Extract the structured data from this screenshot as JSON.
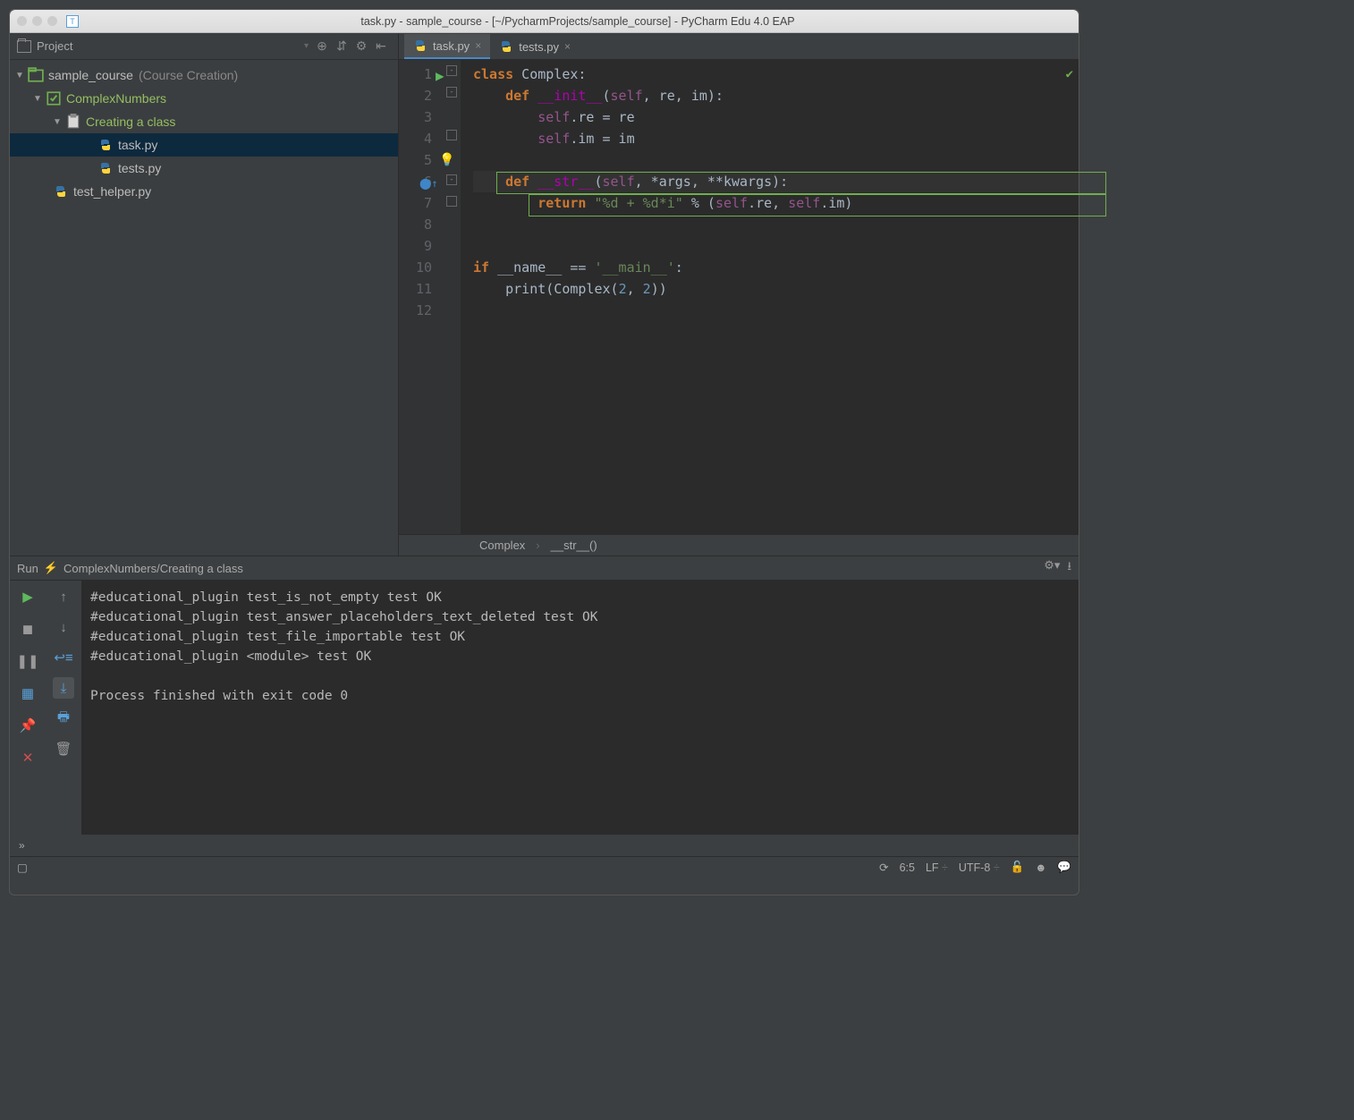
{
  "window": {
    "title": "task.py - sample_course - [~/PycharmProjects/sample_course] - PyCharm Edu 4.0 EAP"
  },
  "sidebar": {
    "header": "Project",
    "root": "sample_course",
    "root_hint": "(Course Creation)",
    "items": {
      "lesson": "ComplexNumbers",
      "task": "Creating a class",
      "file1": "task.py",
      "file2": "tests.py",
      "helper": "test_helper.py"
    }
  },
  "tabs": {
    "t0": "task.py",
    "t1": "tests.py"
  },
  "code": {
    "l1a": "class",
    "l1b": " Complex:",
    "l2a": "    def ",
    "l2b": "__init__",
    "l2c": "(",
    "l2d": "self",
    "l2e": ", re, im):",
    "l3a": "        ",
    "l3b": "self",
    "l3c": ".re = re",
    "l4a": "        ",
    "l4b": "self",
    "l4c": ".im = im",
    "l6a": "    def ",
    "l6b": "__str__",
    "l6c": "(",
    "l6d": "self",
    "l6e": ", *args, **kwargs):",
    "l7a": "        return ",
    "l7b": "\"%d + %d*i\"",
    "l7c": " % (",
    "l7d": "self",
    "l7e": ".re, ",
    "l7f": "self",
    "l7g": ".im)",
    "l10a": "if ",
    "l10b": "__name__ == ",
    "l10c": "'__main__'",
    "l10d": ":",
    "l11a": "    ",
    "l11b": "print",
    "l11c": "(Complex(",
    "l11d": "2",
    "l11e": ", ",
    "l11f": "2",
    "l11g": "))"
  },
  "gutter": [
    "1",
    "2",
    "3",
    "4",
    "5",
    "6",
    "7",
    "8",
    "9",
    "10",
    "11",
    "12"
  ],
  "breadcrumb": {
    "a": "Complex",
    "b": "__str__()"
  },
  "run": {
    "label": "Run",
    "target": "ComplexNumbers/Creating a class",
    "lines": [
      "#educational_plugin test_is_not_empty test OK",
      "#educational_plugin test_answer_placeholders_text_deleted test OK",
      "#educational_plugin test_file_importable test OK",
      "#educational_plugin <module> test OK",
      "",
      "Process finished with exit code 0"
    ]
  },
  "status": {
    "pos": "6:5",
    "le": "LF",
    "enc": "UTF-8"
  }
}
